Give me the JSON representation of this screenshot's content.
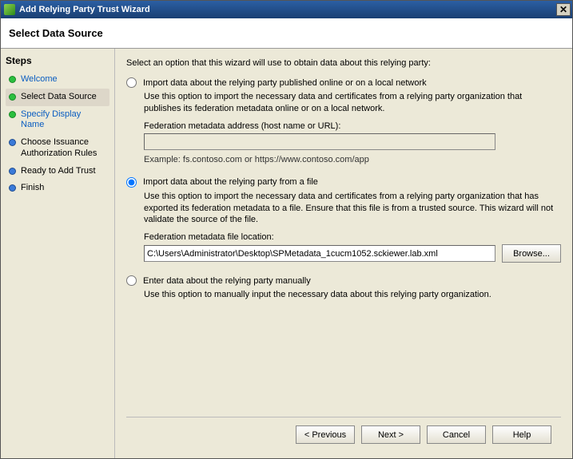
{
  "window": {
    "title": "Add Relying Party Trust Wizard"
  },
  "header": {
    "title": "Select Data Source"
  },
  "sidebar": {
    "heading": "Steps",
    "items": [
      {
        "label": "Welcome",
        "bullet": "green",
        "state": "link"
      },
      {
        "label": "Select Data Source",
        "bullet": "green",
        "state": "current"
      },
      {
        "label": "Specify Display Name",
        "bullet": "green",
        "state": "link"
      },
      {
        "label": "Choose Issuance Authorization Rules",
        "bullet": "blue",
        "state": "plain"
      },
      {
        "label": "Ready to Add Trust",
        "bullet": "blue",
        "state": "plain"
      },
      {
        "label": "Finish",
        "bullet": "blue",
        "state": "plain"
      }
    ]
  },
  "content": {
    "instruction": "Select an option that this wizard will use to obtain data about this relying party:",
    "option_online": {
      "label": "Import data about the relying party published online or on a local network",
      "desc": "Use this option to import the necessary data and certificates from a relying party organization that publishes its federation metadata online or on a local network.",
      "field_label": "Federation metadata address (host name or URL):",
      "value": "",
      "example": "Example: fs.contoso.com or https://www.contoso.com/app"
    },
    "option_file": {
      "label": "Import data about the relying party from a file",
      "desc": "Use this option to import the necessary data and certificates from a relying party organization that has exported its federation metadata to a file. Ensure that this file is from a trusted source.  This wizard will not validate the source of the file.",
      "field_label": "Federation metadata file location:",
      "value": "C:\\Users\\Administrator\\Desktop\\SPMetadata_1cucm1052.sckiewer.lab.xml",
      "browse": "Browse..."
    },
    "option_manual": {
      "label": "Enter data about the relying party manually",
      "desc": "Use this option to manually input the necessary data about this relying party organization."
    }
  },
  "footer": {
    "previous": "< Previous",
    "next": "Next >",
    "cancel": "Cancel",
    "help": "Help"
  }
}
